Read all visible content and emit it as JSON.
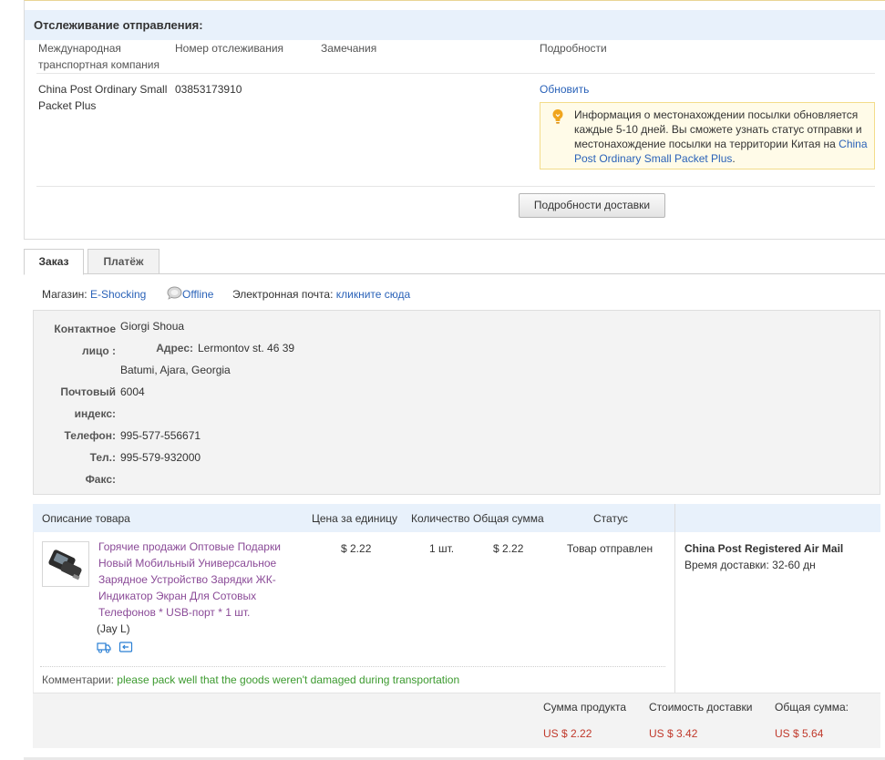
{
  "tracking": {
    "title": "Отслеживание отправления:",
    "col_company": "Международная транспортная компания",
    "col_company_l1": "Международная",
    "col_company_l2": "транспортная компания",
    "col_number": "Номер отслеживания",
    "col_remarks": "Замечания",
    "col_details": "Подробности",
    "company_l1": "China Post Ordinary Small",
    "company_l2": "Packet Plus",
    "number": "03853173910",
    "refresh_link": "Обновить",
    "notice_text": "Информация о местонахождении посылки обновляется каждые 5-10 дней. Вы сможете узнать статус отправки и местонахождение посылки на территории Китая на",
    "notice_link": "China Post Ordinary Small Packet Plus",
    "notice_end": ".",
    "details_button": "Подробности доставки"
  },
  "tabs": [
    {
      "label": "Заказ",
      "active": true
    },
    {
      "label": "Платёж",
      "active": false
    }
  ],
  "store": {
    "label": "Магазин:",
    "name": "E-Shocking",
    "status": "Offline",
    "email_label": "Электронная почта:",
    "email_link": "кликните сюда"
  },
  "contact": {
    "person_label_l1": "Контактное",
    "person_label_l2": "лицо :",
    "person": "Giorgi Shoua",
    "address_label": "Адрес:",
    "address_l1": "Lermontov st. 46 39",
    "address_l2": "Batumi, Ajara, Georgia",
    "zip_label_l1": "Почтовый",
    "zip_label_l2": "индекс:",
    "zip": "6004",
    "phone_label": "Телефон:",
    "phone": "995-577-556671",
    "tel_label": "Тел.:",
    "tel": "995-579-932000",
    "fax_label": "Факс:",
    "fax": ""
  },
  "products": {
    "headers": {
      "description": "Описание товара",
      "unit_price": "Цена за единицу",
      "quantity": "Количество",
      "total": "Общая сумма",
      "status": "Статус"
    },
    "item": {
      "title_lines": [
        "Горячие продажи Оптовые Подарки",
        "Новый Мобильный Универсальное",
        "Зарядное Устройство Зарядки ЖК-",
        "Индикатор Экран Для Сотовых",
        "Телефонов * USB-порт * 1 шт."
      ],
      "variant": "(Jay L)",
      "unit_price": "$ 2.22",
      "quantity": "1 шт.",
      "total": "$ 2.22",
      "status": "Товар отправлен"
    },
    "shipping": {
      "method": "China Post Registered Air Mail",
      "time_label": "Время доставки:",
      "time_value": "32-60 дн"
    },
    "comment_label": "Комментарии:",
    "comment": "please pack well that the goods weren't damaged during transportation"
  },
  "totals": {
    "product_label": "Сумма продукта",
    "product_value": "US $ 2.22",
    "shipping_label": "Стоимость доставки",
    "shipping_value": "US $ 3.42",
    "total_label": "Общая сумма:",
    "total_value": "US $ 5.64"
  },
  "colors": {
    "link": "#2a62b8",
    "product_link": "#8a4a97",
    "comment": "#3c9a2f",
    "price": "#c0392b",
    "header_bg": "#e8f1fb"
  }
}
